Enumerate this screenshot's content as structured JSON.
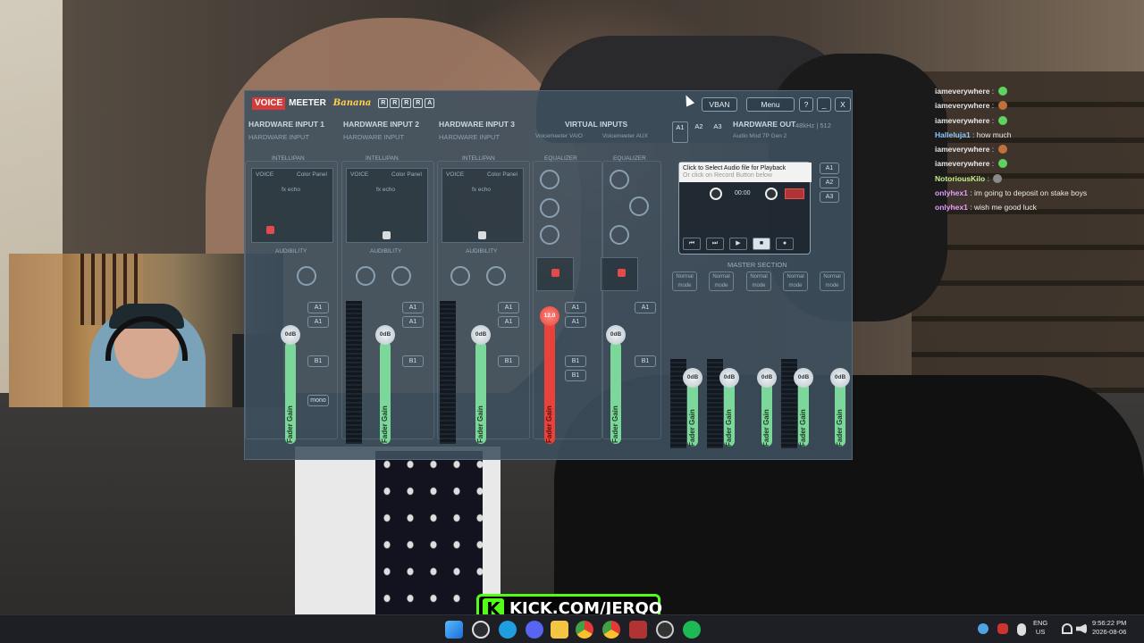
{
  "chat": {
    "messages": [
      {
        "user": "iameverywhere",
        "text": "",
        "color": "#e8e8e8",
        "emote": "#5fd35f"
      },
      {
        "user": "iameverywhere",
        "text": "",
        "color": "#e8e8e8",
        "emote": "#c0703a"
      },
      {
        "user": "iameverywhere",
        "text": "",
        "color": "#e8e8e8",
        "emote": "#5fd35f"
      },
      {
        "user": "Halleluja1",
        "text": "how much",
        "color": "#8ecbff",
        "emote": ""
      },
      {
        "user": "iameverywhere",
        "text": "",
        "color": "#e8e8e8",
        "emote": "#c0703a"
      },
      {
        "user": "iameverywhere",
        "text": "",
        "color": "#e8e8e8",
        "emote": "#5fd35f"
      },
      {
        "user": "NotoriousKilo",
        "text": "",
        "color": "#c8f08a",
        "emote": "#8a8a8a"
      },
      {
        "user": "onlyhex1",
        "text": "im going to deposit on stake boys",
        "color": "#e59cff",
        "emote": ""
      },
      {
        "user": "onlyhex1",
        "text": "wish me good luck",
        "color": "#e59cff",
        "emote": ""
      }
    ]
  },
  "voicemeeter": {
    "logo_voice": "VOICE",
    "logo_meeter": "MEETER",
    "logo_edition": "Banana",
    "r_boxes": [
      "R",
      "R",
      "R",
      "R",
      "A"
    ],
    "vban_label": "VBAN",
    "menu_label": "Menu",
    "help_label": "?",
    "min_label": "_",
    "close_label": "X",
    "hw_input_1": "HARDWARE INPUT 1",
    "hw_input_2": "HARDWARE INPUT 2",
    "hw_input_3": "HARDWARE INPUT 3",
    "hw_input_1_sub": "HARDWARE INPUT",
    "hw_input_2_sub": "HARDWARE INPUT",
    "hw_input_3_sub": "HARDWARE INPUT",
    "virtual_inputs": "VIRTUAL INPUTS",
    "vaio_label": "Voicemeeter VAIO",
    "aux_label": "Voicemeeter AUX",
    "hw_out": "HARDWARE OUT",
    "hw_out_rate": "48kHz | 512",
    "hw_out_sub": "Audio Mod 7P Gen 2",
    "bus_a1": "A1",
    "bus_a2": "A2",
    "bus_a3": "A3",
    "intellipan": "INTELLIPAN",
    "voice": "VOICE",
    "color_panel": "Color Panel",
    "fx_echo": "fx echo",
    "equalizer": "EQUALIZER",
    "audibility": "AUDIBILITY",
    "master_section": "MASTER SECTION",
    "fader_label": "Fader Gain",
    "mono_label": "mono",
    "strip_btn_a1": "A1",
    "strip_btn_b1": "B1",
    "fader_values": [
      "0dB",
      "0dB",
      "0dB",
      "12.0",
      "0dB"
    ],
    "master_values": [
      "0dB",
      "0dB",
      "0dB",
      "0dB",
      "0dB"
    ],
    "master_button": "Normal mode",
    "cassette_tip_line1": "Click to Select Audio file for Playback",
    "cassette_tip_line2": "Or click on Record Button below",
    "cassette_time": "00:00",
    "input_colors": [
      "#e34a4a",
      "#d8dde0",
      "#d8dde0"
    ],
    "fader_green": "#7cd89a",
    "fader_red": "#e8423a"
  },
  "kick_banner": {
    "logo": "K",
    "text": "KICK.COM/JERQO"
  },
  "taskbar": {
    "lang": "ENG",
    "region": "US",
    "time": "9:56:22 PM",
    "date": "2026-08-06"
  }
}
